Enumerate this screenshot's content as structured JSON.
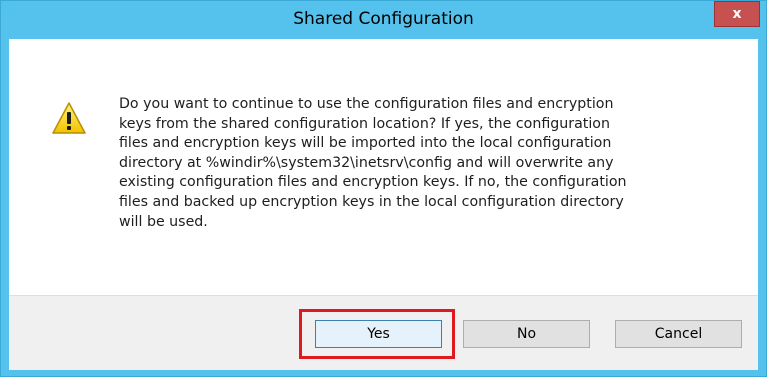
{
  "window": {
    "title": "Shared Configuration",
    "close_label": "x"
  },
  "dialog": {
    "icon": "warning-icon",
    "message": "Do you want to continue to use the configuration files and encryption\nkeys from the shared configuration location? If yes, the configuration\nfiles and encryption keys will be imported into the local configuration\ndirectory at %windir%\\system32\\inetsrv\\config and will overwrite any\nexisting configuration files and encryption keys. If no, the configuration\nfiles and backed up encryption keys in the local configuration directory\nwill be used."
  },
  "buttons": {
    "yes": "Yes",
    "no": "No",
    "cancel": "Cancel"
  },
  "colors": {
    "titlebar": "#54c2ec",
    "close": "#c75050",
    "highlight": "#e0191f",
    "footer": "#f0f0f0"
  }
}
